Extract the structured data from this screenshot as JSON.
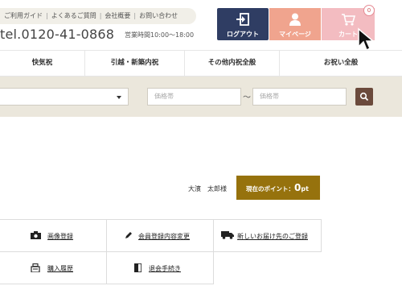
{
  "header": {
    "help_links": [
      "ご利用ガイド",
      "よくあるご質問",
      "会社概要",
      "お問い合わせ"
    ],
    "tel": "tel.0120-41-0868",
    "hours": "営業時間10:00～18:00",
    "buttons": {
      "logout": "ログアウト",
      "mypage": "マイページ",
      "cart": "カート"
    },
    "cart_count": "0"
  },
  "nav": {
    "items": [
      "快気祝",
      "引越・新築内祝",
      "その他内祝全般",
      "お祝い全般"
    ]
  },
  "search": {
    "price_min_placeholder": "価格帯",
    "price_separator": "～",
    "price_max_placeholder": "価格帯"
  },
  "account": {
    "user_name": "大濱　太郎様",
    "points_label": "現在のポイント：",
    "points_value": "0",
    "points_unit": "pt"
  },
  "menu": {
    "image_register": "画像登録",
    "member_info_change": "会員登録内容変更",
    "new_address": "新しいお届け先のご登録",
    "purchase_history": "購入履歴",
    "withdraw": "退会手続き"
  },
  "colors": {
    "logout_bg": "#2f3d63",
    "mypage_bg": "#f0a48e",
    "cart_bg": "#f3bcc1",
    "search_bar_bg": "#ebe7dc",
    "points_bg": "#96720d",
    "search_button_bg": "#6b4a3c"
  }
}
